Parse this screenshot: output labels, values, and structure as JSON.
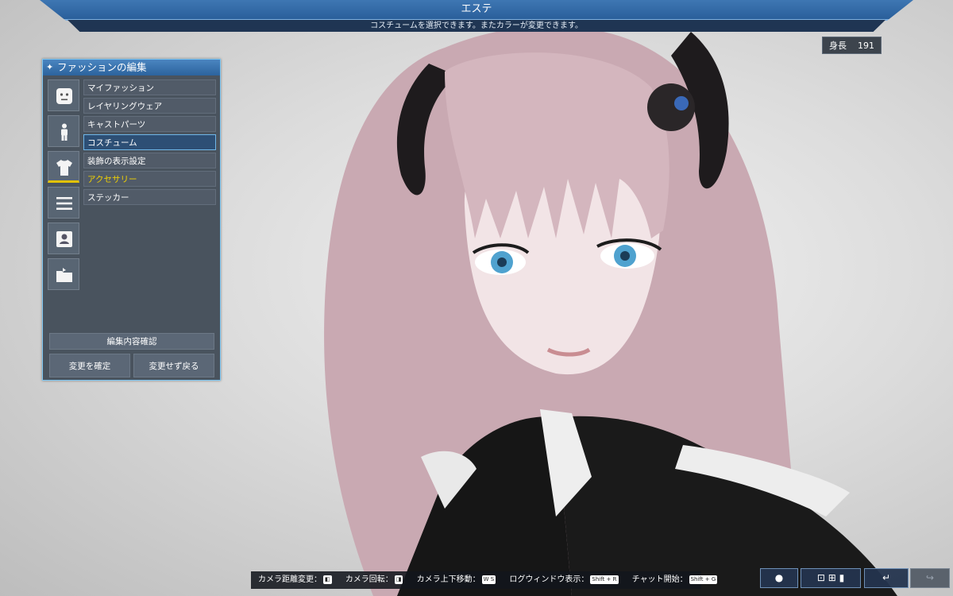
{
  "header": {
    "title": "エステ",
    "subtitle": "コスチュームを選択できます。またカラーが変更できます。"
  },
  "height_display": {
    "label": "身長",
    "value": "191"
  },
  "panel": {
    "title": "ファッションの編集",
    "side_tabs": [
      {
        "icon": "face-icon",
        "active": false
      },
      {
        "icon": "body-icon",
        "active": false
      },
      {
        "icon": "shirt-icon",
        "active": true
      },
      {
        "icon": "list-icon",
        "active": false
      },
      {
        "icon": "id-card-icon",
        "active": false
      },
      {
        "icon": "folder-icon",
        "active": false
      }
    ],
    "menu_items": [
      {
        "label": "マイファッション"
      },
      {
        "label": "レイヤリングウェア"
      },
      {
        "label": "キャストパーツ"
      },
      {
        "label": "コスチューム",
        "selected": true
      },
      {
        "label": "装飾の表示設定"
      },
      {
        "label": "アクセサリー",
        "highlight": "#f3d300"
      },
      {
        "label": "ステッカー"
      }
    ],
    "confirm_edit_label": "編集内容確認",
    "apply_label": "変更を確定",
    "cancel_label": "変更せず戻る"
  },
  "controls_hint": {
    "camera_distance": "カメラ距離変更：",
    "camera_rotate": "カメラ回転：",
    "camera_updown": "カメラ上下移動：",
    "camera_updown_keys": "W S",
    "log_window": "ログウィンドウ表示：",
    "log_window_key": "Shift + R",
    "chat": "チャット開始：",
    "chat_key": "Shift + G"
  },
  "colors": {
    "accent_blue": "#3e77b3",
    "panel_border": "#7fc7f2",
    "highlight_yellow": "#f3d300"
  }
}
